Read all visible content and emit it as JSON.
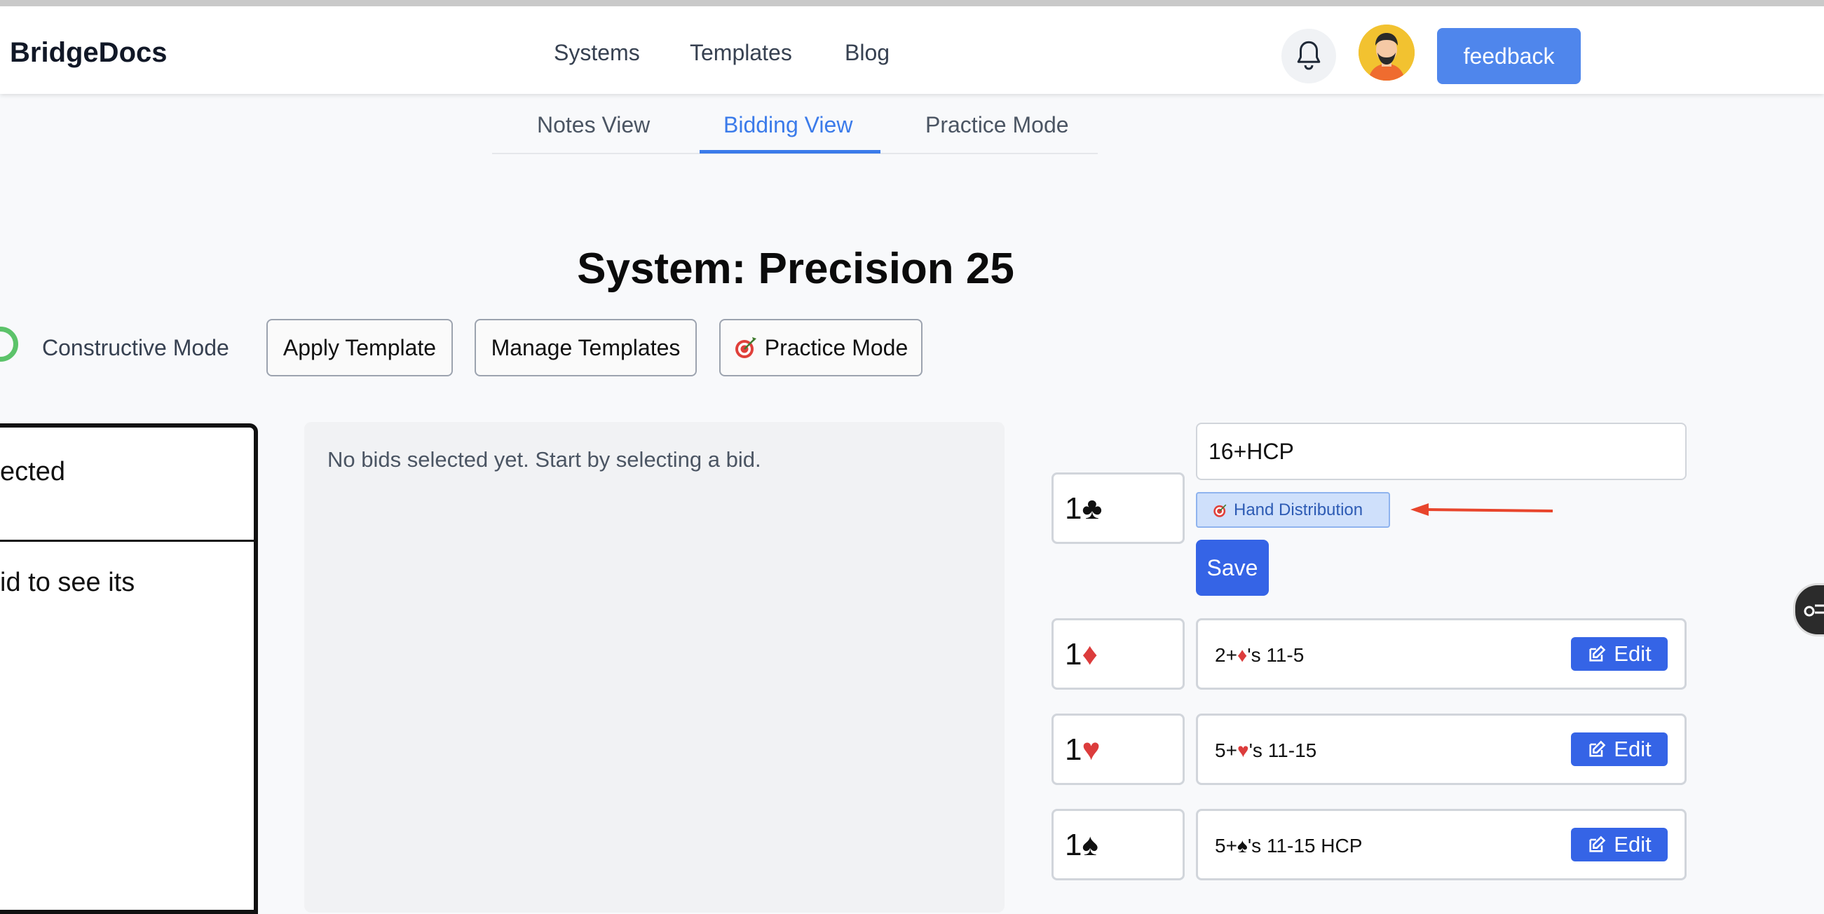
{
  "header": {
    "logo": "BridgeDocs",
    "nav": [
      "Systems",
      "Templates",
      "Blog"
    ],
    "bell_icon": "bell-icon",
    "avatar_icon": "user-avatar",
    "feedback_label": "feedback"
  },
  "view_tabs": [
    "Notes View",
    "Bidding View",
    "Practice Mode"
  ],
  "active_tab": "Bidding View",
  "page_title": "System: Precision 25",
  "toolbar": {
    "mode_label": "Constructive Mode",
    "apply_template": "Apply Template",
    "manage_templates": "Manage Templates",
    "practice_mode": "Practice Mode",
    "practice_icon": "target-icon"
  },
  "left_panel": {
    "header_text": "ected",
    "body_text": "id to see its"
  },
  "center_panel": {
    "empty_text": "No bids selected yet. Start by selecting a bid."
  },
  "editing_bid": {
    "level": "1",
    "suit": "♣",
    "description_value": "16+HCP",
    "tag_label": "Hand Distribution",
    "tag_icon": "target-icon",
    "save_label": "Save"
  },
  "bids": [
    {
      "level": "1",
      "suit": "♦",
      "suit_color": "#dc3c3c",
      "desc_prefix": "2+",
      "desc_suit": "♦",
      "desc_suffix": "'s 11-5",
      "edit_label": "Edit"
    },
    {
      "level": "1",
      "suit": "♥",
      "suit_color": "#dc3c3c",
      "desc_prefix": "5+",
      "desc_suit": "♥",
      "desc_suffix": "'s 11-15",
      "edit_label": "Edit"
    },
    {
      "level": "1",
      "suit": "♠",
      "suit_color": "#111111",
      "desc_prefix": "5+",
      "desc_suit": "♠",
      "desc_suffix": "'s 11-15 HCP",
      "edit_label": "Edit"
    }
  ],
  "colors": {
    "accent": "#3b7bea",
    "button_blue": "#3564e6",
    "feedback_blue": "#4f86ec",
    "toggle_green": "#5cc36a",
    "annotation_arrow": "#e8452c"
  }
}
